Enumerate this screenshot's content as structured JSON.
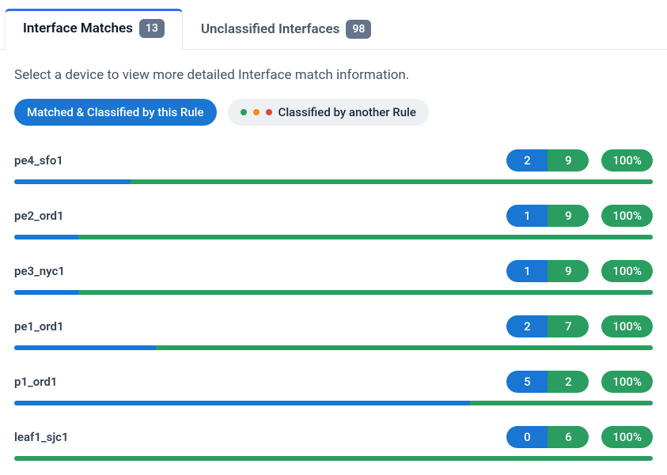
{
  "tabs": [
    {
      "label": "Interface Matches",
      "badge": "13",
      "active": true
    },
    {
      "label": "Unclassified Interfaces",
      "badge": "98",
      "active": false
    }
  ],
  "hint": "Select a device to view more detailed Interface match information.",
  "legend": {
    "primary": "Matched & Classified by this Rule",
    "secondary": "Classified by another Rule"
  },
  "colors": {
    "blue": "#1976d2",
    "green": "#2a9d60",
    "orange": "#f58b1f",
    "red": "#e04646",
    "badge_bg": "#64748b"
  },
  "devices": [
    {
      "name": "pe4_sfo1",
      "blue": 2,
      "green": 9,
      "percent": "100%"
    },
    {
      "name": "pe2_ord1",
      "blue": 1,
      "green": 9,
      "percent": "100%"
    },
    {
      "name": "pe3_nyc1",
      "blue": 1,
      "green": 9,
      "percent": "100%"
    },
    {
      "name": "pe1_ord1",
      "blue": 2,
      "green": 7,
      "percent": "100%"
    },
    {
      "name": "p1_ord1",
      "blue": 5,
      "green": 2,
      "percent": "100%"
    },
    {
      "name": "leaf1_sjc1",
      "blue": 0,
      "green": 6,
      "percent": "100%"
    }
  ]
}
